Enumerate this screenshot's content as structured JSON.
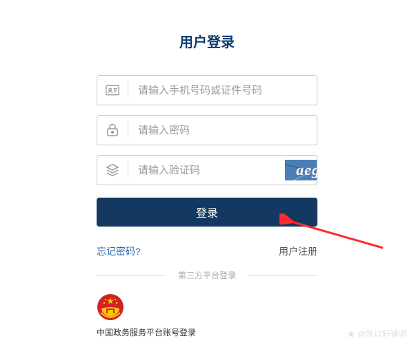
{
  "title": "用户登录",
  "form": {
    "account_placeholder": "请输入手机号码或证件号码",
    "password_placeholder": "请输入密码",
    "captcha_placeholder": "请输入验证码",
    "captcha_text": "aege",
    "login_button": "登录"
  },
  "links": {
    "forgot": "忘记密码?",
    "register": "用户注册"
  },
  "third_party": {
    "divider_label": "第三方平台登录",
    "gov_label": "中国政务服务平台账号登录"
  },
  "icons": {
    "account": "id-card-icon",
    "password": "lock-icon",
    "captcha": "layers-icon",
    "gov": "national-emblem-icon"
  },
  "colors": {
    "primary": "#133862",
    "title": "#0d3a6e",
    "link": "#2a6ab5"
  },
  "watermark": "★ @陈以轩律师"
}
